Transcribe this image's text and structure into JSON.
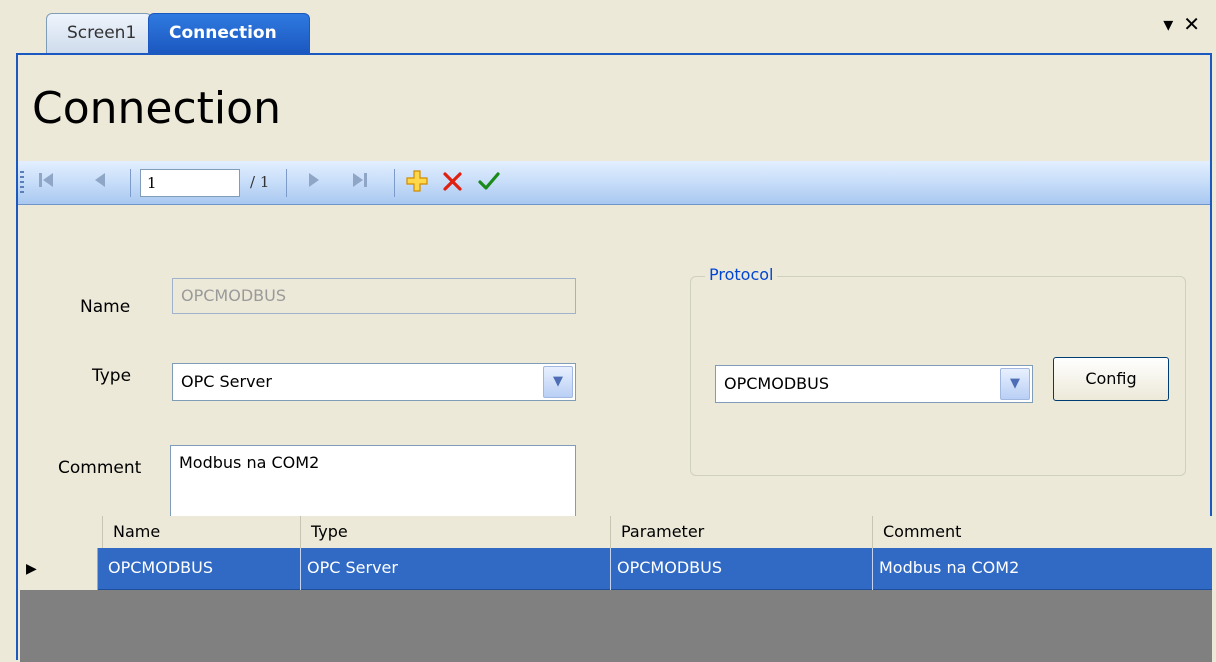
{
  "tabs": [
    {
      "label": "Screen1",
      "active": false
    },
    {
      "label": "Connection",
      "active": true
    }
  ],
  "window_controls": {
    "dropdown": "▾",
    "close": "✕"
  },
  "header": {
    "title": "Connection"
  },
  "toolbar": {
    "position_value": "1",
    "total_label": "/ 1",
    "icons": [
      "first-record-icon",
      "prev-record-icon",
      "next-record-icon",
      "last-record-icon",
      "add-icon",
      "delete-icon",
      "save-check-icon"
    ],
    "colors": {
      "add": "#f0a800",
      "delete": "#e02010",
      "save": "#1a8a1a"
    }
  },
  "form": {
    "name_label": "Name",
    "name_value": "OPCMODBUS",
    "type_label": "Type",
    "type_value": "OPC Server",
    "comment_label": "Comment",
    "comment_value": "Modbus na COM2"
  },
  "protocol": {
    "group_title": "Protocol",
    "value": "OPCMODBUS",
    "config_label": "Config"
  },
  "grid": {
    "columns": [
      "Name",
      "Type",
      "Parameter",
      "Comment"
    ],
    "rows": [
      {
        "name": "OPCMODBUS",
        "type": "OPC Server",
        "parameter": "OPCMODBUS",
        "comment": "Modbus na COM2",
        "selected": true
      }
    ],
    "selection_color": "#316ac5"
  }
}
